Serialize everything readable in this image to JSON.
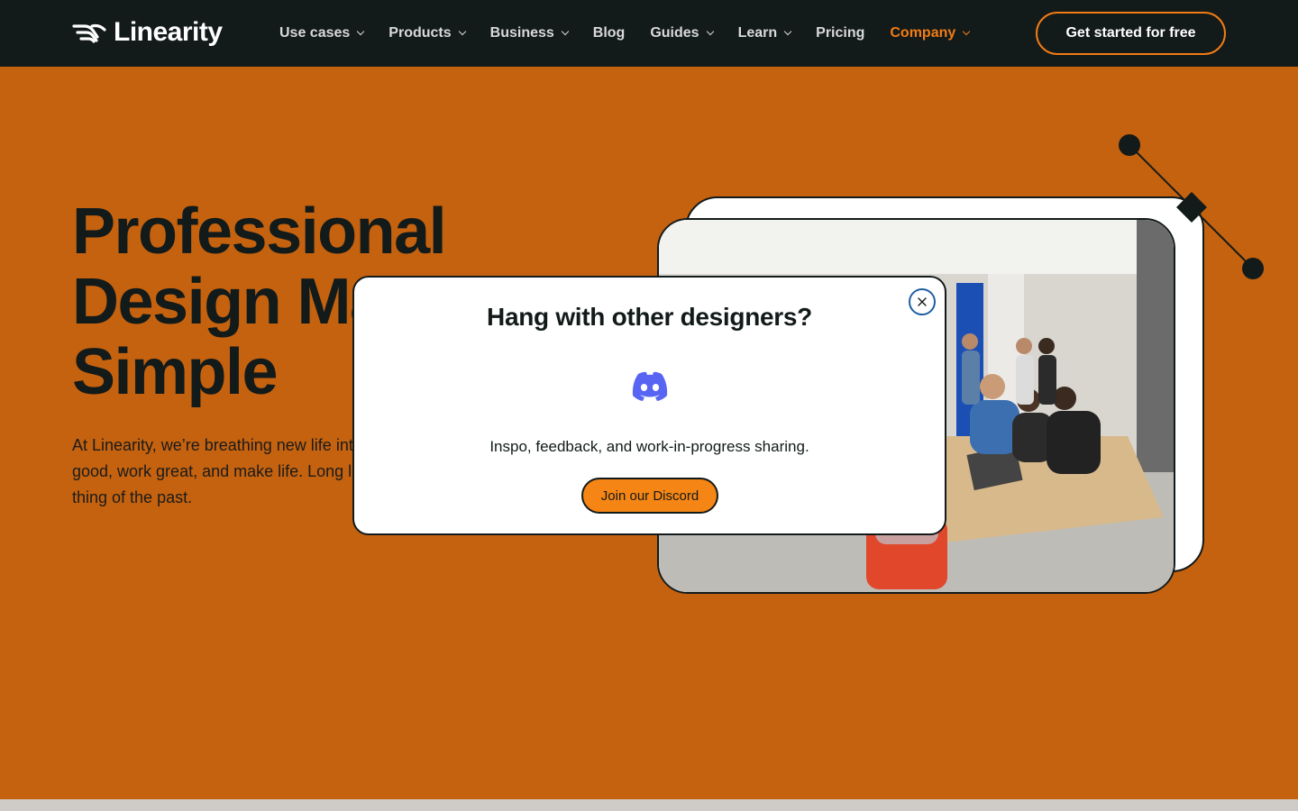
{
  "logo": {
    "text": "Linearity",
    "icon": "linearity-logo-icon"
  },
  "nav": {
    "items": [
      {
        "label": "Use cases",
        "dropdown": true
      },
      {
        "label": "Products",
        "dropdown": true
      },
      {
        "label": "Business",
        "dropdown": true
      },
      {
        "label": "Blog",
        "dropdown": false
      },
      {
        "label": "Guides",
        "dropdown": true
      },
      {
        "label": "Learn",
        "dropdown": true
      },
      {
        "label": "Pricing",
        "dropdown": false
      },
      {
        "label": "Company",
        "dropdown": true,
        "active": true
      }
    ],
    "cta": "Get started for free"
  },
  "hero": {
    "title_lines": [
      "Professional",
      "Design Made",
      "Simple"
    ],
    "body": "At Linearity, we’re breathing new life into design by creating tools that feel good, work great, and make life. Long learning curves and complexity are a thing of the past."
  },
  "modal": {
    "title": "Hang with other designers?",
    "text": "Inspo, feedback, and work-in-progress sharing.",
    "button": "Join our Discord",
    "icon": "discord-icon",
    "close_icon": "close-icon"
  },
  "colors": {
    "nav_bg": "#131a1a",
    "hero_bg": "#c4620f",
    "accent": "#f07c15",
    "discord": "#5865f2",
    "close_ring": "#1f5fa3"
  }
}
